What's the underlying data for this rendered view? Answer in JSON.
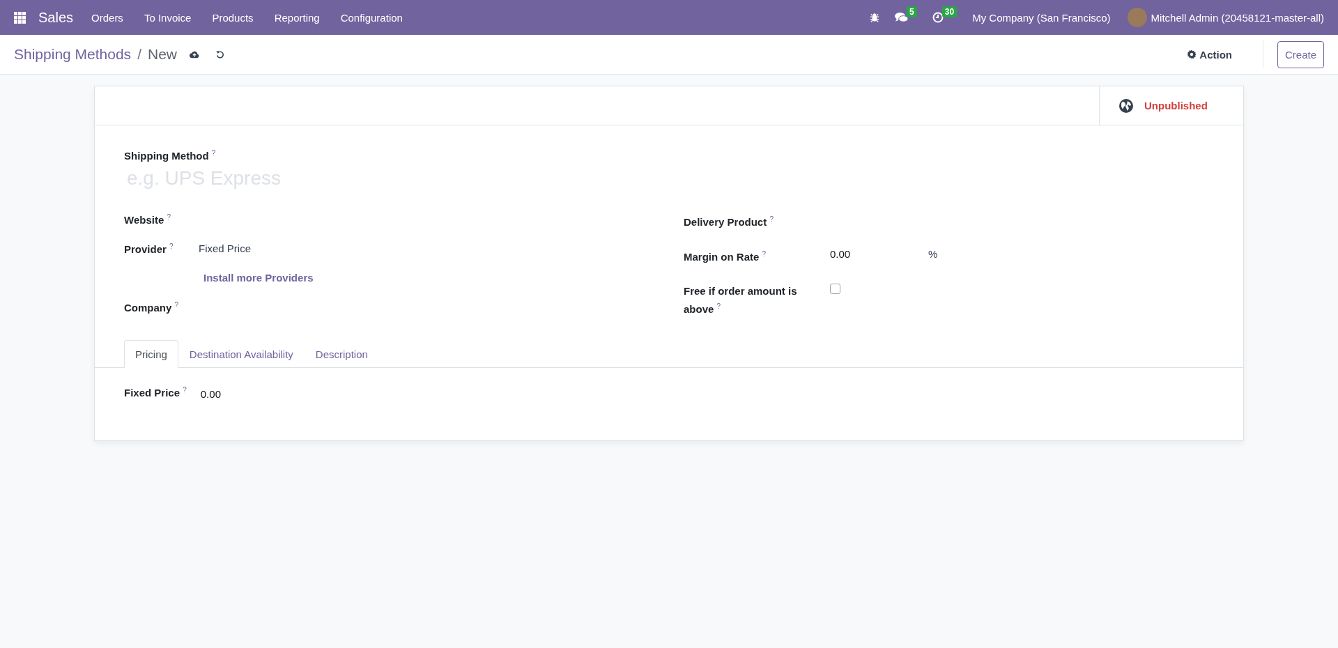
{
  "navbar": {
    "app": "Sales",
    "menus": [
      "Orders",
      "To Invoice",
      "Products",
      "Reporting",
      "Configuration"
    ],
    "systray": [
      {
        "kind": "bug"
      },
      {
        "kind": "chat",
        "badge": "5"
      },
      {
        "kind": "clock",
        "badge": "30"
      }
    ],
    "company": "My Company (San Francisco)",
    "user": "Mitchell Admin (20458121-master-all)"
  },
  "control_panel": {
    "breadcrumb": [
      "Shipping Methods",
      "New"
    ],
    "separator": "/",
    "action": "Action",
    "create": "Create"
  },
  "form": {
    "status": {
      "label": "Unpublished",
      "published": false
    },
    "title_field": {
      "label": "Shipping Method",
      "help": "?",
      "placeholder": "e.g. UPS Express"
    },
    "left_fields": [
      {
        "kind": "text",
        "label": "Website",
        "help": "?"
      },
      {
        "kind": "text",
        "label": "Provider",
        "help": "?",
        "value": "Fixed Price"
      },
      {
        "kind": "link",
        "value": "Install more Providers"
      },
      {
        "kind": "text",
        "label": "Company",
        "help": "?"
      }
    ],
    "right_fields": [
      {
        "kind": "text",
        "label": "Delivery Product",
        "help": "?"
      },
      {
        "kind": "number",
        "label": "Margin on Rate",
        "help": "?",
        "value": "0.00",
        "suffix": "%"
      },
      {
        "kind": "checkbox",
        "label": "Free if order amount is above",
        "help": "?",
        "checked": false
      }
    ],
    "tabs": [
      {
        "label": "Pricing",
        "selected": true
      },
      {
        "label": "Destination Availability",
        "selected": false
      },
      {
        "label": "Description",
        "selected": false
      }
    ],
    "tab_fields": [
      {
        "label": "Fixed Price",
        "help": "?",
        "value": "0.00"
      }
    ]
  }
}
